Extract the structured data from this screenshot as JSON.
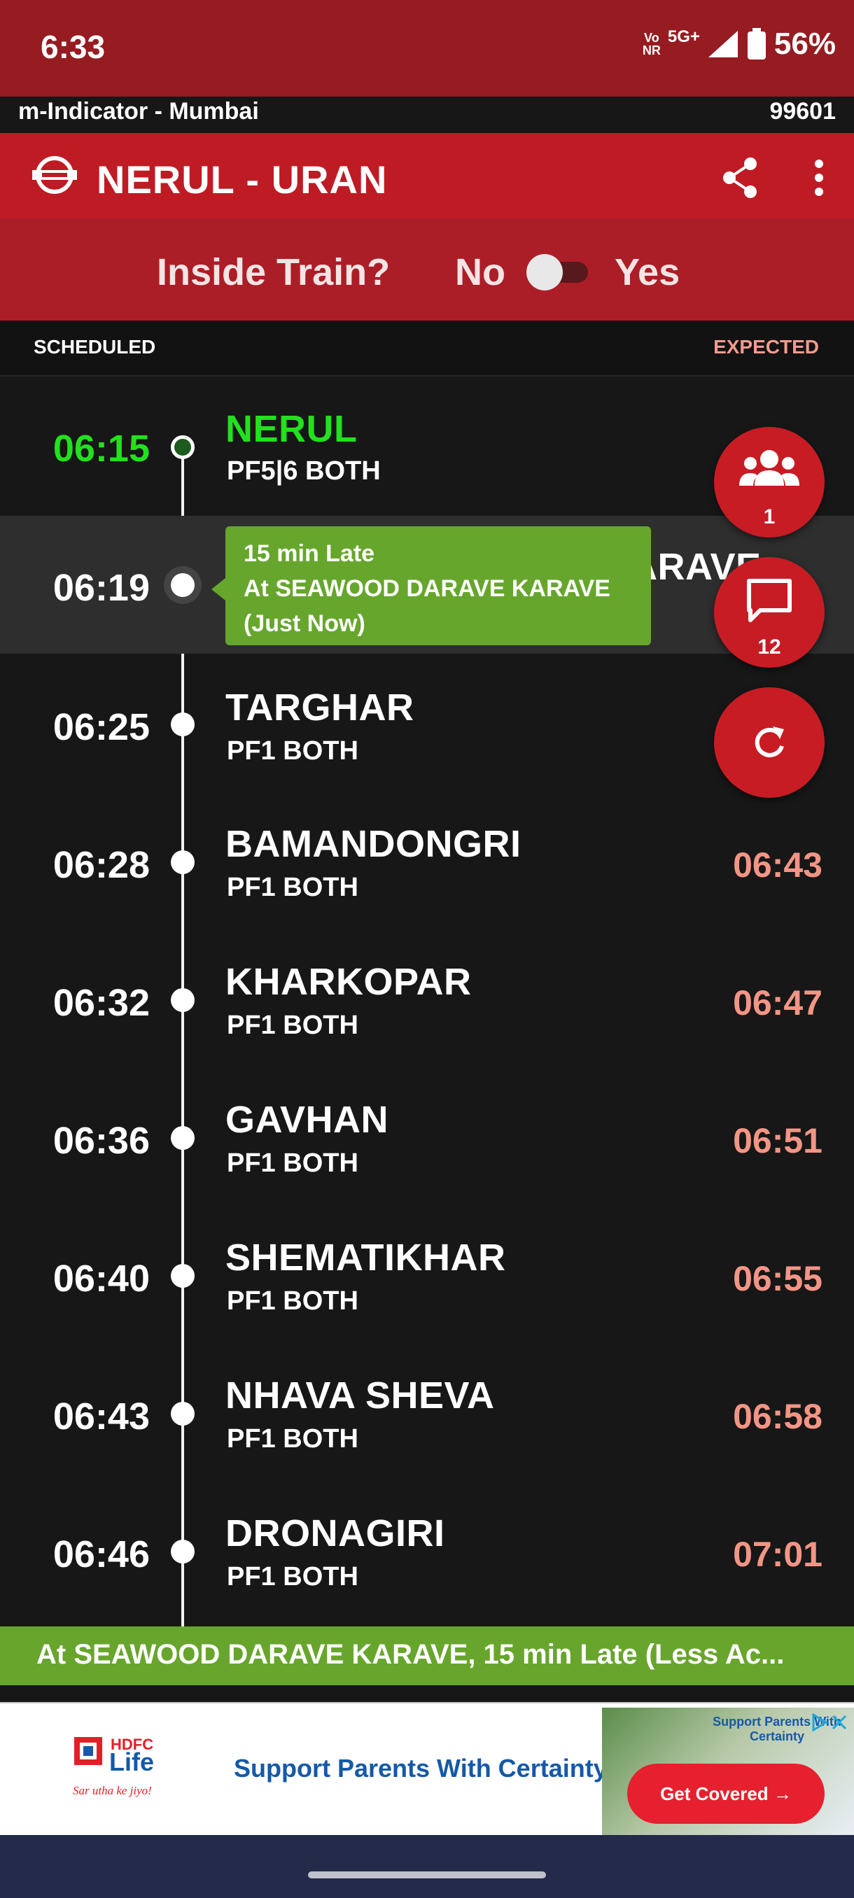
{
  "status": {
    "time": "6:33",
    "volte": "Voℙ\nNR",
    "volte_top": "Vo",
    "volte_bottom": "NR",
    "network": "5G+",
    "battery": "56%"
  },
  "app": {
    "name": "m-Indicator - Mumbai",
    "train_number": "99601"
  },
  "header": {
    "title": "NERUL - URAN",
    "share_icon": "share-icon",
    "more_icon": "more-vert-icon"
  },
  "inside_train": {
    "label": "Inside Train?",
    "no": "No",
    "yes": "Yes",
    "toggle_on": false
  },
  "columns": {
    "scheduled": "SCHEDULED",
    "expected": "EXPECTED"
  },
  "stations": [
    {
      "time": "06:15",
      "name": "NERUL",
      "platform": "PF5|6 BOTH",
      "expected": ""
    },
    {
      "time": "06:19",
      "name": "SEAWOOD DARAVE KARAVE",
      "name_visible": "ARAVE",
      "platform": "",
      "expected": ""
    },
    {
      "time": "06:25",
      "name": "TARGHAR",
      "platform": "PF1 BOTH",
      "expected": ""
    },
    {
      "time": "06:28",
      "name": "BAMANDONGRI",
      "platform": "PF1 BOTH",
      "expected": "06:43"
    },
    {
      "time": "06:32",
      "name": "KHARKOPAR",
      "platform": "PF1 BOTH",
      "expected": "06:47"
    },
    {
      "time": "06:36",
      "name": "GAVHAN",
      "platform": "PF1 BOTH",
      "expected": "06:51"
    },
    {
      "time": "06:40",
      "name": "SHEMATIKHAR",
      "platform": "PF1 BOTH",
      "expected": "06:55"
    },
    {
      "time": "06:43",
      "name": "NHAVA SHEVA",
      "platform": "PF1 BOTH",
      "expected": "06:58"
    },
    {
      "time": "06:46",
      "name": "DRONAGIRI",
      "platform": "PF1 BOTH",
      "expected": "07:01"
    }
  ],
  "live_status": {
    "line1": "15 min Late",
    "line2": "At SEAWOOD DARAVE KARAVE",
    "line3": "(Just Now)"
  },
  "fabs": {
    "people_count": "1",
    "chat_count": "12",
    "people_icon": "group-icon",
    "chat_icon": "chat-icon",
    "refresh_icon": "refresh-icon"
  },
  "banner": "At SEAWOOD DARAVE KARAVE, 15 min Late (Less Ac...",
  "ad": {
    "brand_top": "HDFC",
    "brand_bottom": "Life",
    "slogan": "Sar utha ke jiyo!",
    "text": "Support Parents With Certainty",
    "tagline": "Support Parents With Certainty",
    "button": "Get Covered →"
  },
  "colors": {
    "status_bar": "#961c21",
    "title_bar": "#bf1b24",
    "accent_green": "#66a62d",
    "expected_text": "#f39585",
    "station_current": "#22e11e"
  }
}
